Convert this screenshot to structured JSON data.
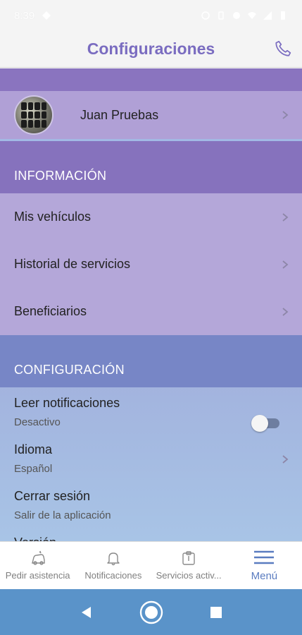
{
  "status_bar": {
    "time": "8:39"
  },
  "header": {
    "title": "Configuraciones"
  },
  "profile": {
    "name": "Juan Pruebas"
  },
  "sections": {
    "info": {
      "title": "INFORMACIÓN",
      "items": [
        {
          "label": "Mis vehículos"
        },
        {
          "label": "Historial de servicios"
        },
        {
          "label": "Beneficiarios"
        }
      ]
    },
    "config": {
      "title": "CONFIGURACIÓN",
      "notifications": {
        "label": "Leer notificaciones",
        "status": "Desactivo",
        "enabled": false
      },
      "language": {
        "label": "Idioma",
        "value": "Español"
      },
      "logout": {
        "label": "Cerrar sesión",
        "subtitle": "Salir de la aplicación"
      },
      "version": {
        "label": "Versión"
      }
    }
  },
  "bottom_nav": {
    "items": [
      {
        "label": "Pedir asistencia",
        "icon": "car-crash-icon"
      },
      {
        "label": "Notificaciones",
        "icon": "bell-icon"
      },
      {
        "label": "Servicios activ...",
        "icon": "clipboard-icon"
      },
      {
        "label": "Menú",
        "icon": "hamburger-menu-icon",
        "active": true
      }
    ]
  },
  "colors": {
    "accent": "#7a6cc0",
    "info_band": "#8672bd",
    "config_band": "#7786c6",
    "nav_active": "#5a7cc0",
    "system_nav": "#5a93c9"
  }
}
